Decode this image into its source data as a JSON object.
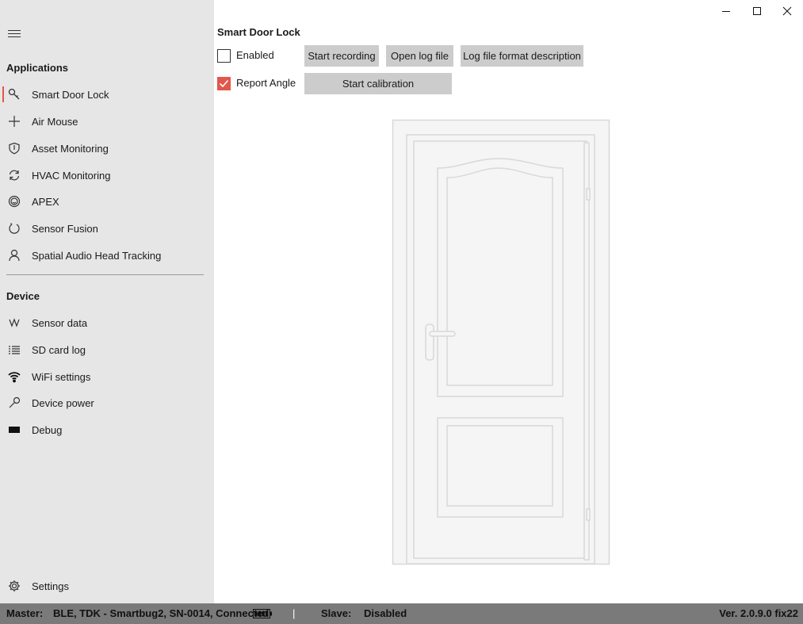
{
  "window": {
    "minimize_icon": "minimize-icon",
    "maximize_icon": "maximize-icon",
    "close_icon": "close-icon"
  },
  "sidebar": {
    "menu_icon": "hamburger-icon",
    "applications_heading": "Applications",
    "applications": [
      {
        "label": "Smart Door Lock",
        "icon": "key-icon",
        "active": true
      },
      {
        "label": "Air Mouse",
        "icon": "plus-icon"
      },
      {
        "label": "Asset Monitoring",
        "icon": "shield-icon"
      },
      {
        "label": "HVAC Monitoring",
        "icon": "refresh-icon"
      },
      {
        "label": "APEX",
        "icon": "smiley-icon"
      },
      {
        "label": "Sensor Fusion",
        "icon": "power-icon"
      },
      {
        "label": "Spatial Audio Head Tracking",
        "icon": "person-icon"
      }
    ],
    "device_heading": "Device",
    "device": [
      {
        "label": "Sensor data",
        "icon": "waveform-icon"
      },
      {
        "label": "SD card log",
        "icon": "list-icon"
      },
      {
        "label": "WiFi settings",
        "icon": "wifi-icon"
      },
      {
        "label": "Device power",
        "icon": "wrench-icon"
      },
      {
        "label": "Debug",
        "icon": "terminal-icon"
      }
    ],
    "settings_label": "Settings",
    "settings_icon": "gear-icon"
  },
  "main": {
    "title": "Smart Door Lock",
    "enabled": {
      "label": "Enabled",
      "checked": false
    },
    "report_angle": {
      "label": "Report Angle",
      "checked": true
    },
    "buttons": {
      "start_recording": "Start recording",
      "open_log_file": "Open log file",
      "log_format": "Log file format description",
      "start_calibration": "Start calibration"
    },
    "illustration": "door-illustration"
  },
  "status_bar": {
    "master_label": "Master:",
    "master_value": "BLE, TDK - Smartbug2, SN-0014, Connected",
    "battery_icon": "battery-icon",
    "separator": "|",
    "slave_label": "Slave:",
    "slave_value": "Disabled",
    "version": "Ver. 2.0.9.0 fix22"
  },
  "colors": {
    "accent": "#e2574c",
    "sidebar_bg": "#e6e6e6",
    "button_bg": "#cccccc",
    "status_bg": "#7a7a7a"
  }
}
